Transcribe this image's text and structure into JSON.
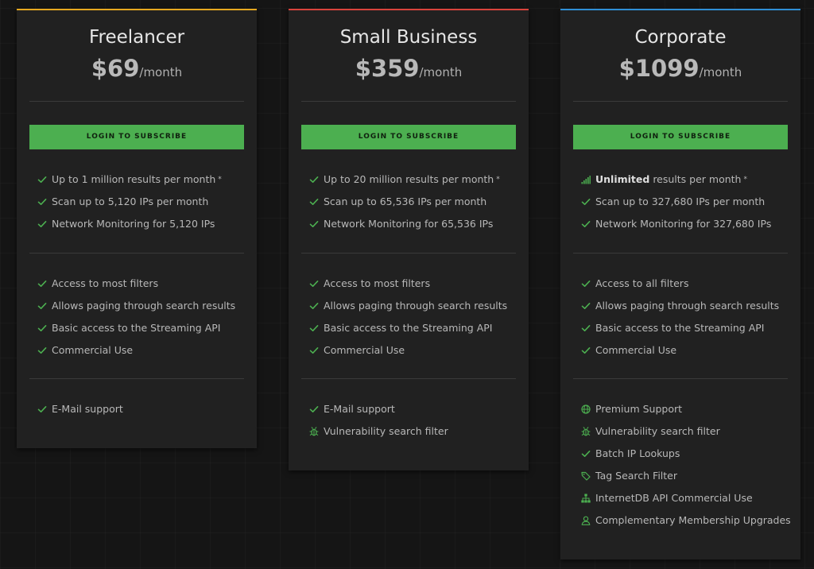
{
  "plans": [
    {
      "name": "Freelancer",
      "price": "$69",
      "period": "/month",
      "accent": "#e6a820",
      "button": "LOGIN TO SUBSCRIBE",
      "results_prefix": "Up to 1 million results per month",
      "results_asterisk": "*",
      "scan": "Scan up to 5,120 IPs per month",
      "monitoring": "Network Monitoring for 5,120 IPs",
      "filters": "Access to most filters",
      "paging": "Allows paging through search results",
      "streaming": "Basic access to the Streaming API",
      "commercial": "Commercial Use",
      "support": [
        {
          "icon": "check-icon",
          "label": "E-Mail support"
        }
      ]
    },
    {
      "name": "Small Business",
      "price": "$359",
      "period": "/month",
      "accent": "#d9433c",
      "button": "LOGIN TO SUBSCRIBE",
      "results_prefix": "Up to 20 million results per month",
      "results_asterisk": "*",
      "scan": "Scan up to 65,536 IPs per month",
      "monitoring": "Network Monitoring for 65,536 IPs",
      "filters": "Access to most filters",
      "paging": "Allows paging through search results",
      "streaming": "Basic access to the Streaming API",
      "commercial": "Commercial Use",
      "support": [
        {
          "icon": "check-icon",
          "label": "E-Mail support"
        },
        {
          "icon": "bug-icon",
          "label": "Vulnerability search filter"
        }
      ]
    },
    {
      "name": "Corporate",
      "price": "$1099",
      "period": "/month",
      "accent": "#2f8fd6",
      "button": "LOGIN TO SUBSCRIBE",
      "results_bold": "Unlimited",
      "results_rest": " results per month",
      "results_asterisk": "*",
      "scan": "Scan up to 327,680 IPs per month",
      "monitoring": "Network Monitoring for 327,680 IPs",
      "filters": "Access to all filters",
      "paging": "Allows paging through search results",
      "streaming": "Basic access to the Streaming API",
      "commercial": "Commercial Use",
      "support": [
        {
          "icon": "globe-icon",
          "label": "Premium Support"
        },
        {
          "icon": "bug-icon",
          "label": "Vulnerability search filter"
        },
        {
          "icon": "check-icon",
          "label": "Batch IP Lookups"
        },
        {
          "icon": "tag-icon",
          "label": "Tag Search Filter"
        },
        {
          "icon": "sitemap-icon",
          "label": "InternetDB API Commercial Use"
        },
        {
          "icon": "user-icon",
          "label": "Complementary Membership Upgrades"
        }
      ]
    }
  ],
  "colors": {
    "accent_green": "#4caf50",
    "card_bg": "#212121",
    "page_bg": "#151515"
  }
}
